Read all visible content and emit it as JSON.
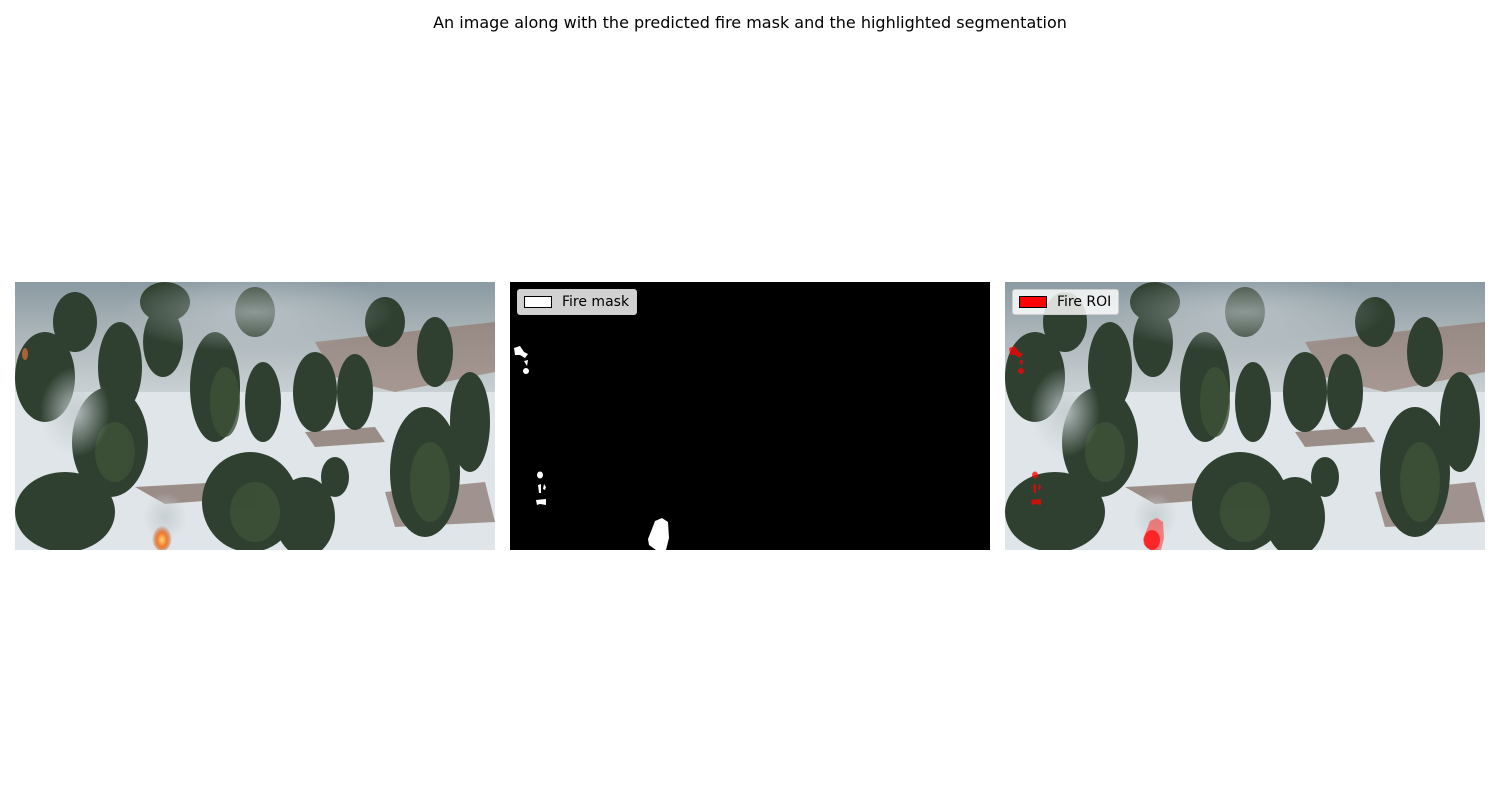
{
  "figure": {
    "title": "An image along with the predicted fire mask and the highlighted segmentation"
  },
  "panels": [
    {
      "name": "original-image"
    },
    {
      "name": "fire-mask",
      "legend": {
        "label": "Fire mask",
        "swatch_color": "#ffffff"
      }
    },
    {
      "name": "highlighted-segmentation",
      "legend": {
        "label": "Fire ROI",
        "swatch_color": "#ff0000"
      }
    }
  ],
  "colors": {
    "mask_background": "#000000",
    "mask_foreground": "#ffffff",
    "roi_highlight": "#ff0000",
    "snow": "#e6ebee",
    "forest": "#34452f"
  }
}
